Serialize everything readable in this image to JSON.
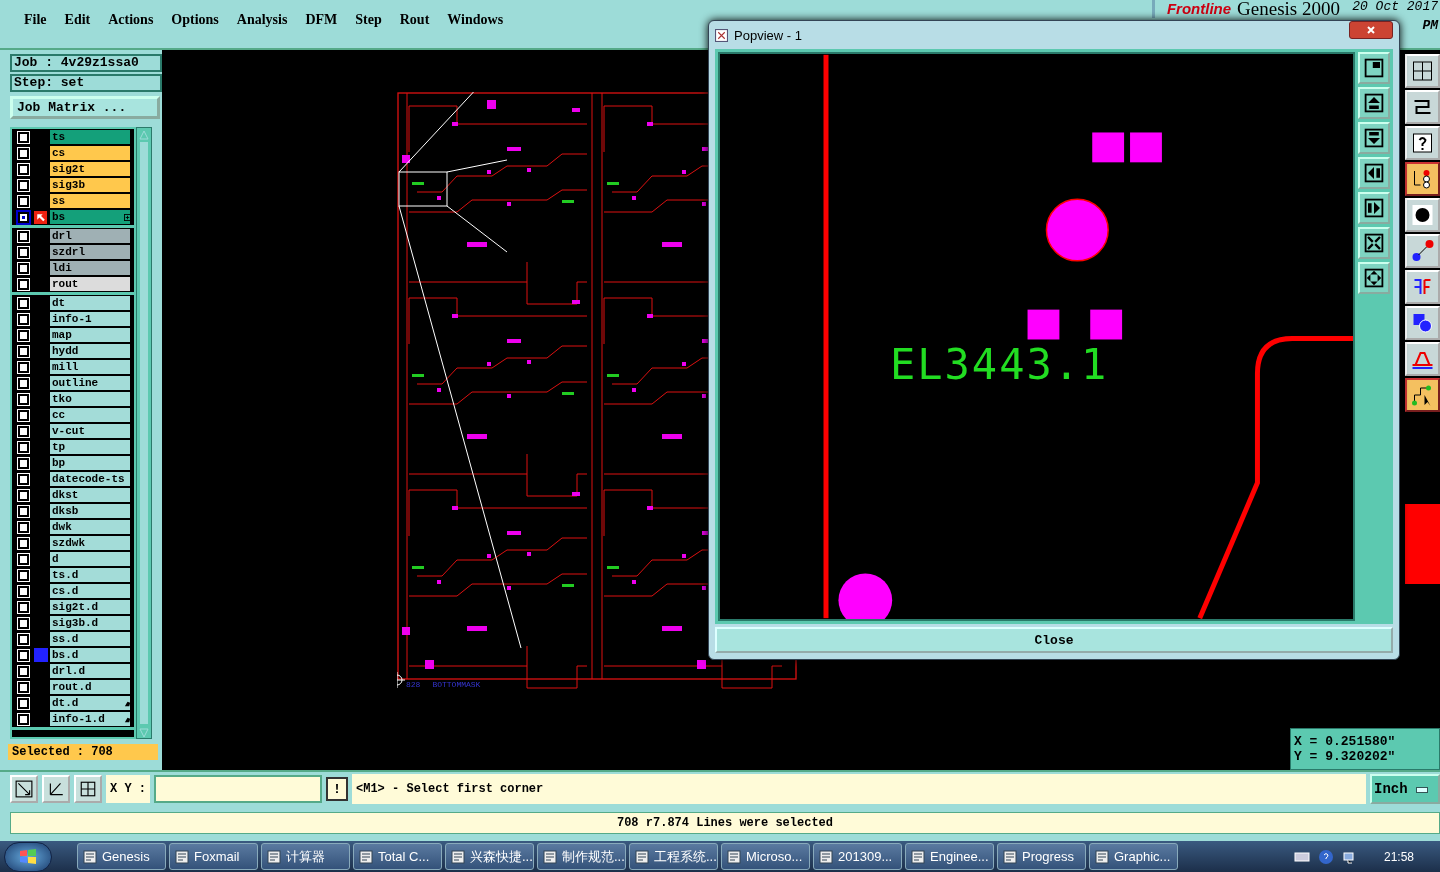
{
  "menu": [
    "File",
    "Edit",
    "Actions",
    "Options",
    "Analysis",
    "DFM",
    "Step",
    "Rout",
    "Windows"
  ],
  "header": {
    "logo": "Frontline",
    "product": "Genesis 2000",
    "date": "20 Oct 2017",
    "time": "PM"
  },
  "job": {
    "job": "Job : 4v29z1ssa0",
    "step": "Step: set",
    "matrix_button": "Job Matrix ..."
  },
  "layer_groups": [
    [
      {
        "name": "ts",
        "color": "#14a07a",
        "work": false,
        "affected": false,
        "marked": false,
        "attached": false
      },
      {
        "name": "cs",
        "color": "#ffc84c",
        "work": false,
        "affected": false,
        "marked": false,
        "attached": false
      },
      {
        "name": "sig2t",
        "color": "#ffc84c",
        "work": false,
        "affected": false,
        "marked": false,
        "attached": false
      },
      {
        "name": "sig3b",
        "color": "#ffc84c",
        "work": false,
        "affected": false,
        "marked": false,
        "attached": false
      },
      {
        "name": "ss",
        "color": "#ffc84c",
        "work": false,
        "affected": false,
        "marked": false,
        "attached": false
      },
      {
        "name": "bs",
        "color": "#14a07a",
        "work": true,
        "affected": true,
        "marked": false,
        "attached": false
      }
    ],
    [
      {
        "name": "drl",
        "color": "#9fb0b4",
        "work": false,
        "affected": false,
        "marked": false,
        "attached": false
      },
      {
        "name": "szdrl",
        "color": "#9fb0b4",
        "work": false,
        "affected": false,
        "marked": false,
        "attached": false
      },
      {
        "name": "ldi",
        "color": "#9fb0b4",
        "work": false,
        "affected": false,
        "marked": false,
        "attached": false
      },
      {
        "name": "rout",
        "color": "#dcdcdc",
        "work": false,
        "affected": false,
        "marked": false,
        "attached": false
      }
    ],
    [
      {
        "name": "dt",
        "color": "#a3dcd8",
        "work": false,
        "affected": false,
        "marked": false,
        "attached": false
      },
      {
        "name": "info-1",
        "color": "#a3dcd8",
        "work": false,
        "affected": false,
        "marked": false,
        "attached": false
      },
      {
        "name": "map",
        "color": "#a3dcd8",
        "work": false,
        "affected": false,
        "marked": false,
        "attached": false
      },
      {
        "name": "hydd",
        "color": "#a3dcd8",
        "work": false,
        "affected": false,
        "marked": false,
        "attached": false
      },
      {
        "name": "mill",
        "color": "#a3dcd8",
        "work": false,
        "affected": false,
        "marked": false,
        "attached": false
      },
      {
        "name": "outline",
        "color": "#a3dcd8",
        "work": false,
        "affected": false,
        "marked": false,
        "attached": false
      },
      {
        "name": "tko",
        "color": "#a3dcd8",
        "work": false,
        "affected": false,
        "marked": false,
        "attached": false
      },
      {
        "name": "cc",
        "color": "#a3dcd8",
        "work": false,
        "affected": false,
        "marked": false,
        "attached": false
      },
      {
        "name": "v-cut",
        "color": "#a3dcd8",
        "work": false,
        "affected": false,
        "marked": false,
        "attached": false
      },
      {
        "name": "tp",
        "color": "#a3dcd8",
        "work": false,
        "affected": false,
        "marked": false,
        "attached": false
      },
      {
        "name": "bp",
        "color": "#a3dcd8",
        "work": false,
        "affected": false,
        "marked": false,
        "attached": false
      },
      {
        "name": "datecode-ts",
        "color": "#a3dcd8",
        "work": false,
        "affected": false,
        "marked": false,
        "attached": false
      },
      {
        "name": "dkst",
        "color": "#a3dcd8",
        "work": false,
        "affected": false,
        "marked": false,
        "attached": false
      },
      {
        "name": "dksb",
        "color": "#a3dcd8",
        "work": false,
        "affected": false,
        "marked": false,
        "attached": false
      },
      {
        "name": "dwk",
        "color": "#a3dcd8",
        "work": false,
        "affected": false,
        "marked": false,
        "attached": false
      },
      {
        "name": "szdwk",
        "color": "#a3dcd8",
        "work": false,
        "affected": false,
        "marked": false,
        "attached": false
      },
      {
        "name": "d",
        "color": "#a3dcd8",
        "work": false,
        "affected": false,
        "marked": false,
        "attached": false
      },
      {
        "name": "ts.d",
        "color": "#a3dcd8",
        "work": false,
        "affected": false,
        "marked": false,
        "attached": false
      },
      {
        "name": "cs.d",
        "color": "#a3dcd8",
        "work": false,
        "affected": false,
        "marked": false,
        "attached": false
      },
      {
        "name": "sig2t.d",
        "color": "#a3dcd8",
        "work": false,
        "affected": false,
        "marked": false,
        "attached": false
      },
      {
        "name": "sig3b.d",
        "color": "#a3dcd8",
        "work": false,
        "affected": false,
        "marked": false,
        "attached": false
      },
      {
        "name": "ss.d",
        "color": "#a3dcd8",
        "work": false,
        "affected": false,
        "marked": false,
        "attached": false
      },
      {
        "name": "bs.d",
        "color": "#a3dcd8",
        "work": false,
        "affected": false,
        "marked": true,
        "attached": false
      },
      {
        "name": "drl.d",
        "color": "#a3dcd8",
        "work": false,
        "affected": false,
        "marked": false,
        "attached": false
      },
      {
        "name": "rout.d",
        "color": "#a3dcd8",
        "work": false,
        "affected": false,
        "marked": false,
        "attached": false
      },
      {
        "name": "dt.d",
        "color": "#a3dcd8",
        "work": false,
        "affected": false,
        "marked": false,
        "attached": true
      },
      {
        "name": "info-1.d",
        "color": "#a3dcd8",
        "work": false,
        "affected": false,
        "marked": false,
        "attached": true
      }
    ]
  ],
  "selected_count": "Selected : 708",
  "canvas": {
    "label_code": "828",
    "label_layer": "BOTTOMMASK"
  },
  "popview": {
    "title": "Popview - 1",
    "close_button": "Close",
    "mirrored_text": "EL3443.1"
  },
  "coordinates": {
    "x": "X = 0.251580\"",
    "y": "Y = 9.320202\""
  },
  "command_bar": {
    "xy_label": "X Y :",
    "bang_button": "!",
    "prompt": "<M1> - Select first corner",
    "units": "Inch"
  },
  "status": "708 r7.874 Lines were selected",
  "taskbar": {
    "items": [
      "Genesis",
      "Foxmail",
      "计算器",
      "Total C...",
      "兴森快捷...",
      "制作规范...",
      "工程系统...",
      "Microso...",
      "201309...",
      "Enginee...",
      "Progress",
      "Graphic..."
    ],
    "clock": "21:58"
  }
}
